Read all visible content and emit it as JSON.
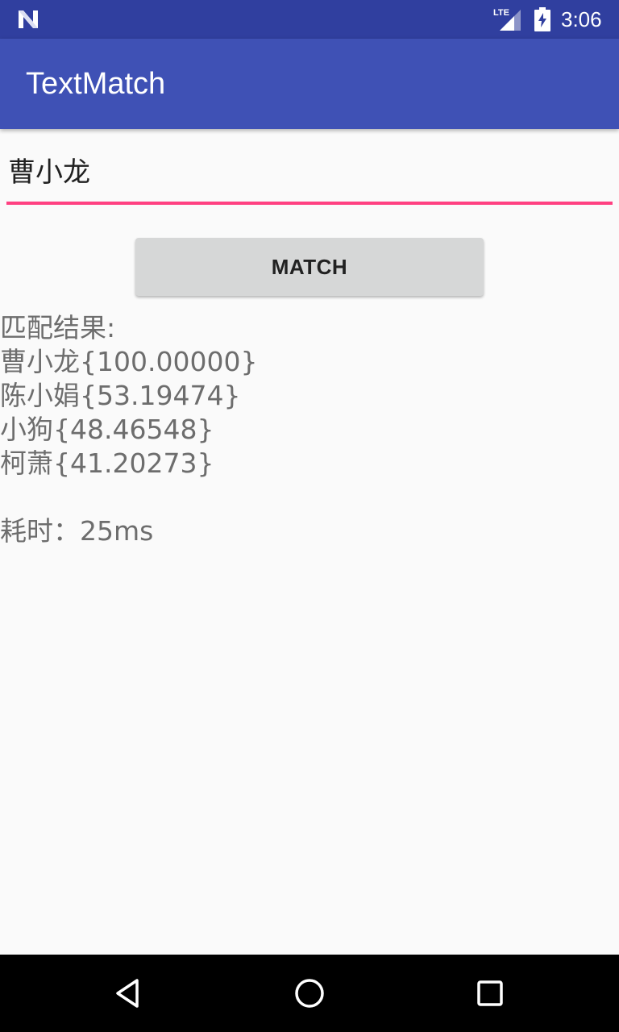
{
  "status_bar": {
    "network_label": "LTE",
    "time": "3:06",
    "icons": [
      "n-notification-icon",
      "lte-signal-icon",
      "battery-charging-icon"
    ]
  },
  "app_bar": {
    "title": "TextMatch"
  },
  "input": {
    "value": "曹小龙"
  },
  "match_button": {
    "label": "MATCH"
  },
  "results": {
    "header": "匹配结果:",
    "items": [
      "曹小龙{100.00000}",
      "陈小娟{53.19474}",
      "小狗{48.46548}",
      "柯萧{41.20273}"
    ],
    "elapsed": "耗时：25ms"
  },
  "nav_bar": {
    "icons": [
      "back-icon",
      "home-icon",
      "recents-icon"
    ]
  },
  "colors": {
    "status_bar": "#303f9f",
    "app_bar": "#3f51b5",
    "accent": "#ff4081",
    "button": "#d6d7d7",
    "result_text": "#6d6d6d"
  }
}
